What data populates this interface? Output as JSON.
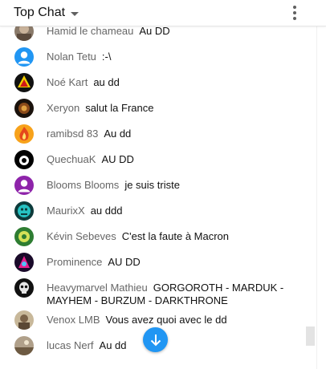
{
  "header": {
    "title": "Top Chat",
    "title_dropdown_icon": "caret-down-icon",
    "menu_icon": "more-vert-icon"
  },
  "messages": [
    {
      "author": "Hamid le chameau",
      "text": "Au DD",
      "avatar": "cropped photo avatar"
    },
    {
      "author": "Nolan Tetu",
      "text": ":-\\",
      "avatar": "default person avatar"
    },
    {
      "author": "Noé Kart",
      "text": "au dd",
      "avatar": "red-yellow logo avatar"
    },
    {
      "author": "Xeryon",
      "text": "salut la France",
      "avatar": "dark photo avatar"
    },
    {
      "author": "ramibsd 83",
      "text": "Au dd",
      "avatar": "fire avatar"
    },
    {
      "author": "QuechuaK",
      "text": "AU DD",
      "avatar": "black white avatar"
    },
    {
      "author": "Blooms Blooms",
      "text": "je suis triste",
      "avatar": "purple letter avatar"
    },
    {
      "author": "MaurixX",
      "text": "au ddd",
      "avatar": "teal character avatar"
    },
    {
      "author": "Kévin Sebeves",
      "text": "C'est la faute à Macron",
      "avatar": "green yellow avatar"
    },
    {
      "author": "Prominence",
      "text": "AU DD",
      "avatar": "neon avatar"
    },
    {
      "author": "Heavymarvel Mathieu",
      "text": "GORGOROTH - MARDUK - MAYHEM - BURZUM - DARKTHRONE",
      "avatar": "skull avatar"
    },
    {
      "author": "Venox LMB",
      "text": "Vous avez quoi avec le dd",
      "avatar": "photo avatar"
    },
    {
      "author": "lucas Nerf",
      "text": "Au dd",
      "avatar": "landscape avatar"
    }
  ],
  "scroll_down_button": {
    "icon": "arrow-down-icon",
    "color": "#2196f3"
  },
  "colors": {
    "author": "#666666",
    "text": "#111111",
    "accent": "#2196f3"
  }
}
